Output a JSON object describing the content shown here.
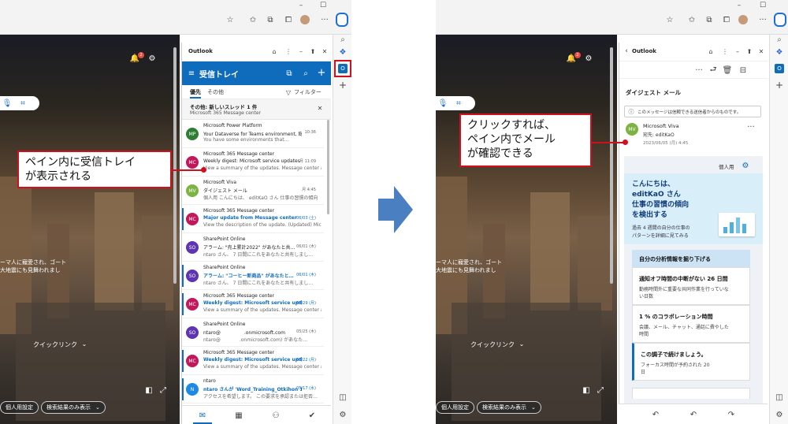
{
  "left": {
    "outlook_title": "Outlook",
    "inbox_title": "受信トレイ",
    "tab_focused": "優先",
    "tab_other": "その他",
    "filter_label": "フィルター",
    "other_banner_title": "その他: 新しいスレッド 1 件",
    "other_banner_sub": "Microsoft 365 Message center",
    "notif_count": "2",
    "quick_links": "クイックリンク",
    "personal_settings": "個人用設定",
    "search_only": "検索結果のみ表示",
    "bg_caption_1": "ーマ人に寵愛され、ゴート",
    "bg_caption_2": "大地震にも見舞われまし",
    "callout_line1": "ペイン内に受信トレイ",
    "callout_line2": "が表示される",
    "mails": [
      {
        "initials": "MP",
        "color": "#2e7d32",
        "from": "Microsoft Power Platform",
        "subject": "Your Dataverse for Teams environment, 総務…",
        "preview": "You have some environments that…",
        "date": "10:36",
        "unread": false
      },
      {
        "initials": "MC",
        "color": "#c2185b",
        "from": "Microsoft 365 Message center",
        "subject": "Weekly digest: Microsoft service updates",
        "preview": "View a summary of the updates. Message center a…",
        "date": "月 11:09",
        "unread": false
      },
      {
        "initials": "MV",
        "color": "#7cb342",
        "from": "Microsoft Viva",
        "subject": "ダイジェスト メール",
        "preview": "個人用 こんにちは、 editKaO さん 仕事の習慣の傾向",
        "date": "月 4:45",
        "unread": false
      },
      {
        "initials": "MC",
        "color": "#c2185b",
        "from": "Microsoft 365 Message center",
        "subject": "Major update from Message center",
        "preview": "View the description of the update. (Updated) Micr…",
        "date": "06/03 (土)",
        "unread": true
      },
      {
        "initials": "SO",
        "color": "#5e35b1",
        "from": "SharePoint Online",
        "subject": "アラーム: \"売上累計2022\" があなたと共…",
        "preview": "ntaro さん、 7 日間にこれをあなたと共有しまし…",
        "date": "06/01 (木)",
        "unread": false
      },
      {
        "initials": "SO",
        "color": "#5e35b1",
        "from": "SharePoint Online",
        "subject": "アラーム: \"コーヒー新商品\" があなたと…",
        "preview": "ntaro さん、 7 日間にこれをあなたと共有しまし…",
        "date": "06/01 (木)",
        "unread": true
      },
      {
        "initials": "MC",
        "color": "#c2185b",
        "from": "Microsoft 365 Message center",
        "subject": "Weekly digest: Microsoft service update…",
        "preview": "View a summary of the updates. Message center a…",
        "date": "05/29 (月)",
        "unread": true
      },
      {
        "initials": "SO",
        "color": "#5e35b1",
        "from": "SharePoint Online",
        "subject": "ntaro@　　　　　.onmicrosoft.com",
        "preview": "ntaro@　　　　.onmicrosoft.com) があなた…",
        "date": "05/25 (木)",
        "unread": false
      },
      {
        "initials": "MC",
        "color": "#c2185b",
        "from": "Microsoft 365 Message center",
        "subject": "Weekly digest: Microsoft service updat…",
        "preview": "View a summary of the updates. Message center a…",
        "date": "05/22 (月)",
        "unread": true
      },
      {
        "initials": "N",
        "color": "#1e88e5",
        "from": "ntaro",
        "subject": "ntaro さんが 'Word_Training_Otkihon 1…",
        "preview": "アクセスを希望します。 この要求を承認または拒否…",
        "date": "05/17 (水)",
        "unread": true
      }
    ]
  },
  "right": {
    "outlook_title": "Outlook",
    "digest_title": "ダイジェスト メール",
    "info_msg": "このメッセージは信頼できる送信者からのものです。",
    "sender": "Microsoft Viva",
    "to": "宛先: editKaO",
    "date": "2023/06/05 (月) 4:45",
    "personal": "個人用",
    "hello_1": "こんにちは、",
    "hello_2": "editKaO さん",
    "hello_3": "仕事の習慣の傾向",
    "hello_4": "を検出する",
    "hello_sub_1": "過去 4 週間の自分の仕事の",
    "hello_sub_2": "パターンを詳細に見てみる",
    "section_title": "自分の分析情報を掘り下げる",
    "item1_title": "通知オフ時間の中断がない 26 日間",
    "item1_desc_1": "勤務時間外に重要な共同作業を行っていな",
    "item1_desc_2": "い日数",
    "item2_title": "1 % のコラボレーション時間",
    "item2_desc_1": "会議、メール、チャット、通話に費やした",
    "item2_desc_2": "時間",
    "item3_title": "この調子で続けましょう。",
    "item3_desc_1": "フォーカス時間が予約された 20",
    "item3_desc_2": "日",
    "quick_links": "クイックリンク",
    "personal_settings": "個人用設定",
    "search_only": "検索結果のみ表示",
    "notif_count": "2",
    "callout_line1": "クリックすれば、",
    "callout_line2": "ペイン内でメール",
    "callout_line3": "が確認できる",
    "bg_caption_1": "ーマ人に寵愛され、ゴート",
    "bg_caption_2": "大地震にも見舞われまし"
  },
  "colors": {
    "accent": "#0f6cbd",
    "callout": "#d0101e",
    "arrow": "#4a7fc1"
  }
}
